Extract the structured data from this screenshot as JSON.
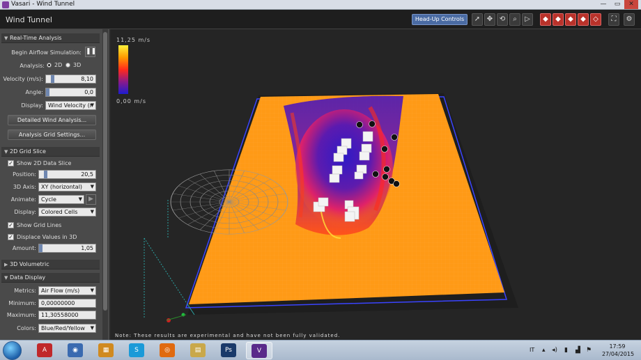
{
  "window": {
    "title": "Vasari - Wind Tunnel"
  },
  "header": {
    "title": "Wind Tunnel",
    "hud_label": "Head-Up Controls"
  },
  "toolbar": {
    "tools": [
      {
        "name": "select-cursor-icon",
        "glyph": "➚"
      },
      {
        "name": "pan-icon",
        "glyph": "✥"
      },
      {
        "name": "orbit-icon",
        "glyph": "⟲"
      },
      {
        "name": "zoom-icon",
        "glyph": "⌕"
      },
      {
        "name": "play-icon",
        "glyph": "▷"
      },
      {
        "name": "view-cube-icon",
        "glyph": "◆"
      },
      {
        "name": "view-front-icon",
        "glyph": "◆"
      },
      {
        "name": "view-side-icon",
        "glyph": "◆"
      },
      {
        "name": "view-top-icon",
        "glyph": "◆"
      },
      {
        "name": "view-iso-icon",
        "glyph": "◇"
      },
      {
        "name": "fit-view-icon",
        "glyph": "⛶"
      },
      {
        "name": "settings-gear-icon",
        "glyph": "⚙"
      }
    ]
  },
  "panel": {
    "realtime": {
      "header": "Real-Time Analysis",
      "begin_label": "Begin Airflow Simulation:",
      "pause_glyph": "❚❚",
      "analysis_label": "Analysis:",
      "opt_2d": "2D",
      "opt_3d": "3D",
      "velocity_label": "Velocity (m/s):",
      "velocity_value": "8,10",
      "angle_label": "Angle:",
      "angle_value": "0,0",
      "display_label": "Display:",
      "display_value": "Wind Velocity (r",
      "detailed_btn": "Detailed Wind Analysis...",
      "grid_btn": "Analysis Grid Settings..."
    },
    "slice": {
      "header": "2D Grid Slice",
      "show_label": "Show 2D Data Slice",
      "position_label": "Position:",
      "position_value": "20,5",
      "axis_label": "3D Axis:",
      "axis_value": "XY (horizontal)",
      "animate_label": "Animate:",
      "animate_value": "Cycle",
      "display_label": "Display:",
      "display_value": "Colored Cells",
      "gridlines_label": "Show Grid Lines",
      "displace_label": "Displace Values in 3D",
      "amount_label": "Amount:",
      "amount_value": "1,05"
    },
    "volumetric": {
      "header": "3D Volumetric"
    },
    "datadisplay": {
      "header": "Data Display",
      "metrics_label": "Metrics:",
      "metrics_value": "Air Flow (m/s)",
      "min_label": "Minimum:",
      "min_value": "0,00000000",
      "max_label": "Maximum:",
      "max_value": "11,30558000",
      "colors_label": "Colors:",
      "colors_value": "Blue/Red/Yellow"
    }
  },
  "legend": {
    "max": "11,25 m/s",
    "min": "0,00 m/s"
  },
  "note": "Note: These results are experimental and have not been fully validated.",
  "taskbar": {
    "apps": [
      "A",
      "◉",
      "▦",
      "S",
      "◎",
      "▤",
      "Ps",
      "V"
    ],
    "lang": "IT",
    "time": "17:59",
    "date": "27/04/2015"
  }
}
